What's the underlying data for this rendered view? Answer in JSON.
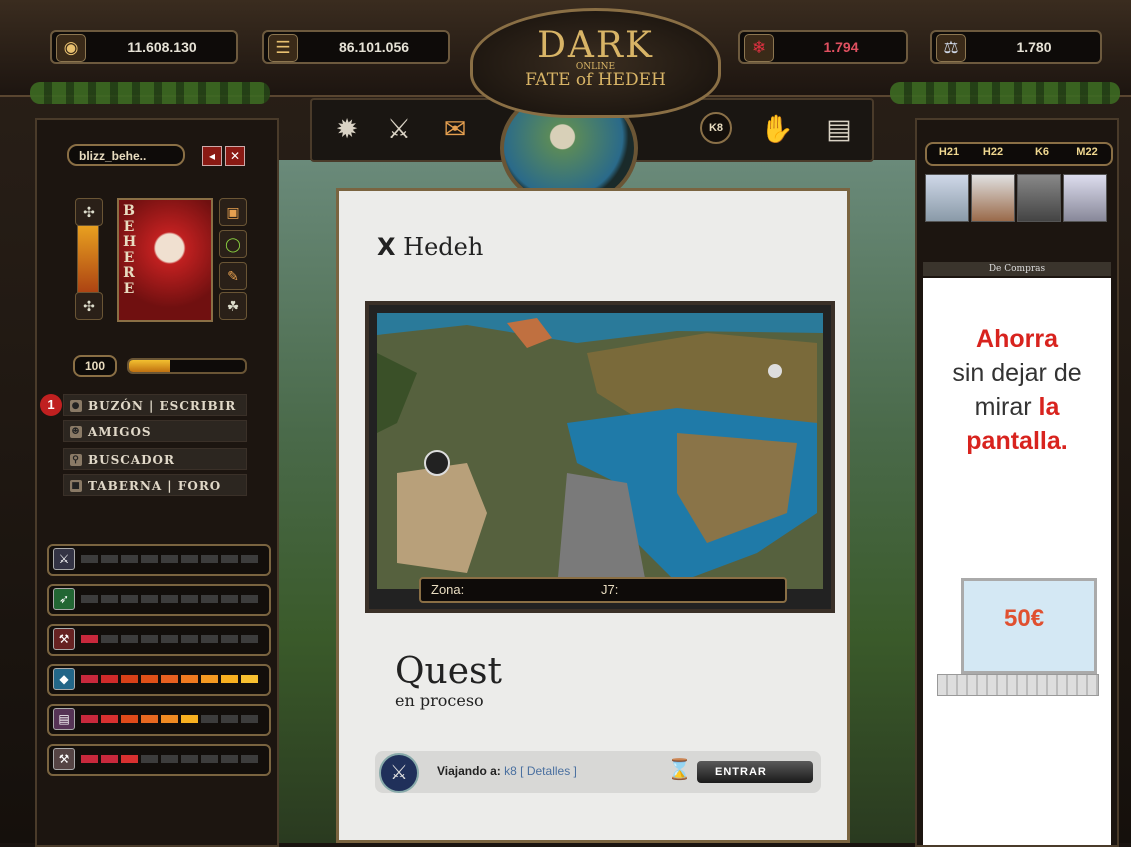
{
  "resources": {
    "gold": "11.608.130",
    "wood": "86.101.056",
    "crystal": "1.794",
    "potion": "1.780"
  },
  "logo": {
    "line1": "DARK",
    "line2": "ONLINE",
    "line3": "FATE of HEDEH"
  },
  "nav": {
    "current_zone": "K8"
  },
  "player": {
    "name": "blizz_behe..",
    "portrait_name": "BEHERE",
    "level": "100",
    "xp_fraction": 0.35
  },
  "menu": {
    "badge": "1",
    "items": [
      "BUZÓN | ESCRIBIR",
      "AMIGOS",
      "BUSCADOR",
      "TABERNA | FORO"
    ]
  },
  "skills": [
    {
      "icon": "sword-icon",
      "filled": 0,
      "colors": []
    },
    {
      "icon": "arrow-icon",
      "filled": 0,
      "colors": []
    },
    {
      "icon": "hammer-icon",
      "filled": 1,
      "colors": [
        "#c8283c"
      ]
    },
    {
      "icon": "shield-icon",
      "filled": 9,
      "colors": [
        "#c8283c",
        "#d02a2a",
        "#d84018",
        "#e05018",
        "#e86020",
        "#f07a20",
        "#f59a22",
        "#f8b020",
        "#f8c030"
      ]
    },
    {
      "icon": "book-icon",
      "filled": 6,
      "colors": [
        "#c8283c",
        "#d83030",
        "#e04a1a",
        "#e86820",
        "#f08a22",
        "#f8b020"
      ]
    },
    {
      "icon": "tools-icon",
      "filled": 3,
      "colors": [
        "#c8283c",
        "#c8283c",
        "#d83030"
      ]
    }
  ],
  "main": {
    "title": "Hedeh",
    "zone_label": "Zona:",
    "zone_value": "J7:",
    "quest_title": "Quest",
    "quest_sub": "en proceso",
    "travel_label": "Viajando a:",
    "travel_dest": "k8",
    "details": "[ Detalles ]",
    "enter": "ENTRAR"
  },
  "cities": [
    "H21",
    "H22",
    "K6",
    "M22"
  ],
  "ad": {
    "header": "De Compras",
    "line1": "Ahorra",
    "line2": "sin dejar de",
    "line3a": "mirar",
    "line3b": "la",
    "line4": "pantalla.",
    "price": "50€",
    "accent": "#d8231e"
  }
}
